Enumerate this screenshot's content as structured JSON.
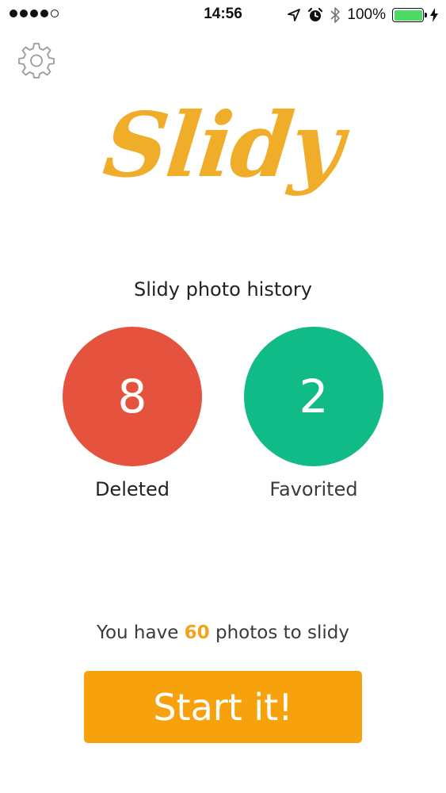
{
  "status_bar": {
    "time": "14:56",
    "battery": "100%",
    "signal_bars": 4
  },
  "settings": {
    "icon": "gear-icon"
  },
  "logo": {
    "text": "Slidy",
    "color": "#f0ad2a"
  },
  "history": {
    "title": "Slidy photo history",
    "deleted": {
      "count": "8",
      "label": "Deleted",
      "color": "#e5533f"
    },
    "favorited": {
      "count": "2",
      "label": "Favorited",
      "color": "#11bb88"
    }
  },
  "remaining": {
    "prefix": "You have",
    "count": "60",
    "suffix": "photos to slidy"
  },
  "start_button": {
    "label": "Start it!",
    "color": "#f7a20d"
  }
}
